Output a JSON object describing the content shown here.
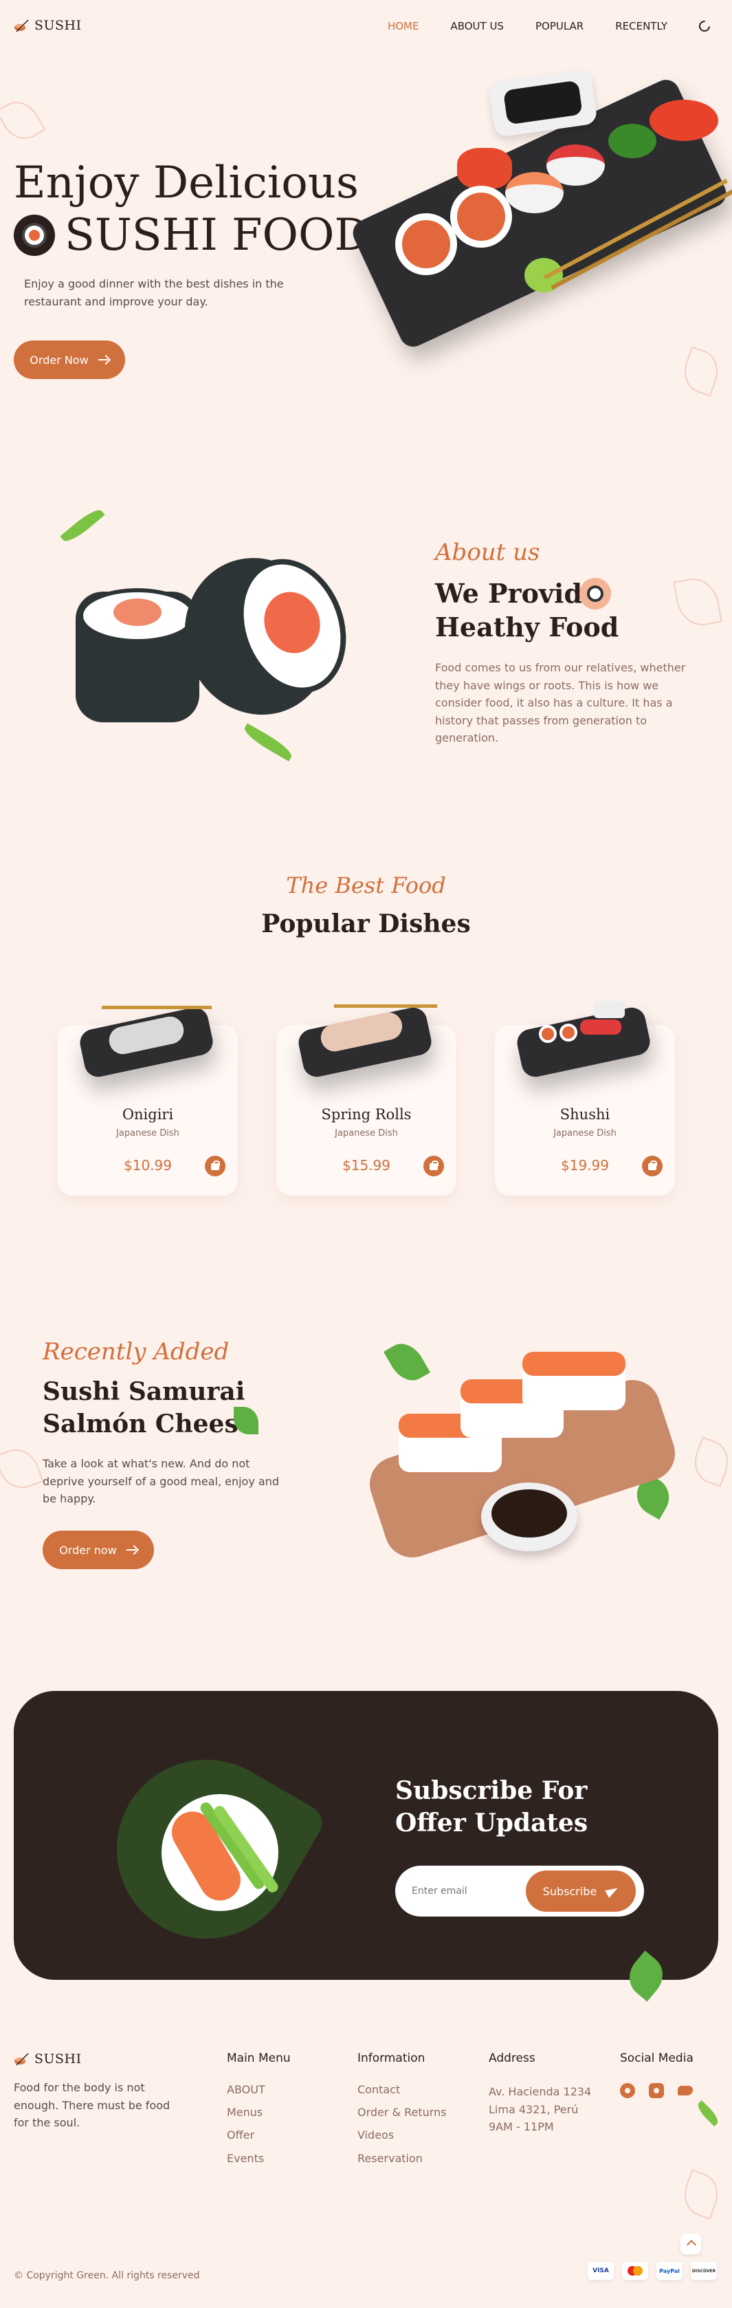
{
  "header": {
    "logo_text": "SUSHI",
    "nav": [
      {
        "label": "HOME",
        "active": true
      },
      {
        "label": "ABOUT US",
        "active": false
      },
      {
        "label": "POPULAR",
        "active": false
      },
      {
        "label": "RECENTLY",
        "active": false
      }
    ],
    "theme_icon": "moon-icon"
  },
  "hero": {
    "title_line1": "Enjoy Delicious",
    "title_line2": "SUSHI FOOD",
    "description": "Enjoy a good dinner with the best dishes in the restaurant and improve your day.",
    "button_label": "Order Now"
  },
  "about": {
    "script_title": "About us",
    "title": "We Provide Heathy Food",
    "text": "Food comes to us from our relatives, whether they have wings or roots. This is how we consider food, it also has a culture. It has a history that passes from generation to generation."
  },
  "popular": {
    "script_title": "The Best Food",
    "title": "Popular Dishes",
    "items": [
      {
        "name": "Onigiri",
        "subtitle": "Japanese Dish",
        "price": "$10.99"
      },
      {
        "name": "Spring Rolls",
        "subtitle": "Japanese Dish",
        "price": "$15.99"
      },
      {
        "name": "Shushi",
        "subtitle": "Japanese Dish",
        "price": "$19.99"
      }
    ]
  },
  "recently": {
    "script_title": "Recently Added",
    "title": "Sushi Samurai Salmón Cheese",
    "text": "Take a look at what's new. And do not deprive yourself of a good meal, enjoy and be happy.",
    "button_label": "Order now"
  },
  "subscribe": {
    "title": "Subscribe For Offer Updates",
    "input_placeholder": "Enter email",
    "button_label": "Subscribe"
  },
  "footer": {
    "logo_text": "SUSHI",
    "description": "Food for the body is not enough. There must be food for the soul.",
    "main_menu": {
      "heading": "Main Menu",
      "links": [
        "ABOUT",
        "Menus",
        "Offer",
        "Events"
      ]
    },
    "information": {
      "heading": "Information",
      "links": [
        "Contact",
        "Order & Returns",
        "Videos",
        "Reservation"
      ]
    },
    "address": {
      "heading": "Address",
      "lines": [
        "Av. Hacienda 1234",
        "Lima 4321, Perú",
        "9AM - 11PM"
      ]
    },
    "social": {
      "heading": "Social Media",
      "icons": [
        "facebook-icon",
        "instagram-icon",
        "twitter-icon"
      ]
    },
    "copyright": "© Copyright Green. All rights reserved",
    "payments": [
      "VISA",
      "mastercard",
      "PayPal",
      "DISCOVER"
    ]
  },
  "colors": {
    "background": "#fdf1ec",
    "accent": "#d0703c",
    "dark": "#2f2320",
    "leaf": "#5fb043"
  }
}
